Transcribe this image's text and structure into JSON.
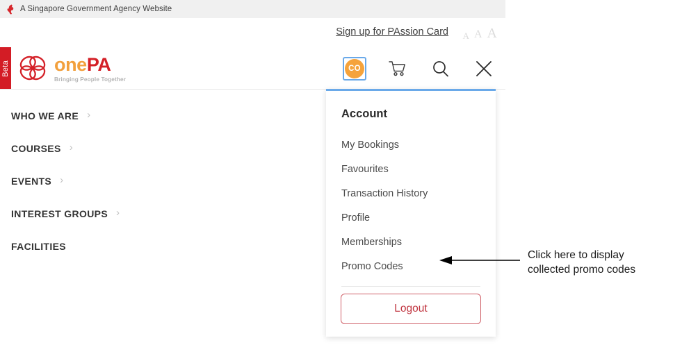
{
  "gov_banner": {
    "text": "A Singapore Government Agency Website",
    "icon": "singapore-lion-icon"
  },
  "utility": {
    "passion_card_link": "Sign up for PAssion Card",
    "font_size_small": "A",
    "font_size_medium": "A",
    "font_size_large": "A"
  },
  "beta_flag": {
    "label": "Beta"
  },
  "brand": {
    "word_one": "one",
    "word_pa": "PA",
    "tagline": "Bringing People Together",
    "logo_color_orange": "#f2a03d",
    "logo_color_red": "#d42027"
  },
  "header_icons": {
    "avatar_initials": "CO",
    "avatar_color": "#f5a33c",
    "focus_ring_color": "#6aa9e9",
    "cart": "cart-icon",
    "search": "search-icon",
    "close": "close-icon"
  },
  "nav": {
    "items": [
      {
        "label": "WHO WE ARE",
        "has_chevron": true
      },
      {
        "label": "COURSES",
        "has_chevron": true
      },
      {
        "label": "EVENTS",
        "has_chevron": true
      },
      {
        "label": "INTEREST GROUPS",
        "has_chevron": true
      },
      {
        "label": "FACILITIES",
        "has_chevron": false
      }
    ],
    "chevron_glyph": "›"
  },
  "dropdown": {
    "title": "Account",
    "items": [
      "My Bookings",
      "Favourites",
      "Transaction History",
      "Profile",
      "Memberships",
      "Promo Codes"
    ],
    "logout_label": "Logout",
    "logout_border_color": "#cf6068",
    "logout_text_color": "#c0343f",
    "top_border_color": "#6aa9e9"
  },
  "annotation": {
    "line1": "Click here to display",
    "line2": "collected promo codes"
  }
}
